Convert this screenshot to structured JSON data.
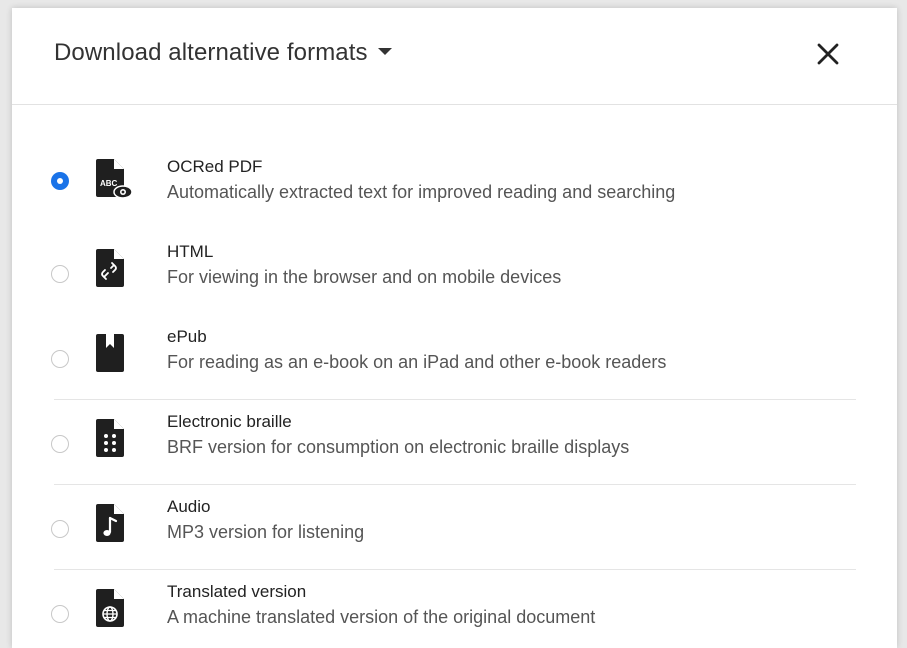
{
  "dialog": {
    "title": "Download alternative formats",
    "close_label": "close"
  },
  "formats": [
    {
      "name": "OCRed PDF",
      "description": "Automatically extracted text for improved reading and searching",
      "icon": "ocr-pdf-icon",
      "selected": true
    },
    {
      "name": "HTML",
      "description": "For viewing in the browser and on mobile devices",
      "icon": "html-link-icon",
      "selected": false
    },
    {
      "name": "ePub",
      "description": "For reading as an e-book on an iPad and other e-book readers",
      "icon": "ebook-bookmark-icon",
      "selected": false
    },
    {
      "name": "Electronic braille",
      "description": "BRF version for consumption on electronic braille displays",
      "icon": "braille-icon",
      "selected": false
    },
    {
      "name": "Audio",
      "description": "MP3 version for listening",
      "icon": "audio-note-icon",
      "selected": false
    },
    {
      "name": "Translated version",
      "description": "A machine translated version of the original document",
      "icon": "globe-icon",
      "selected": false
    }
  ],
  "colors": {
    "accent": "#1a73e8",
    "text_primary": "#222222",
    "text_secondary": "#555555",
    "icon": "#1f1f1f"
  }
}
